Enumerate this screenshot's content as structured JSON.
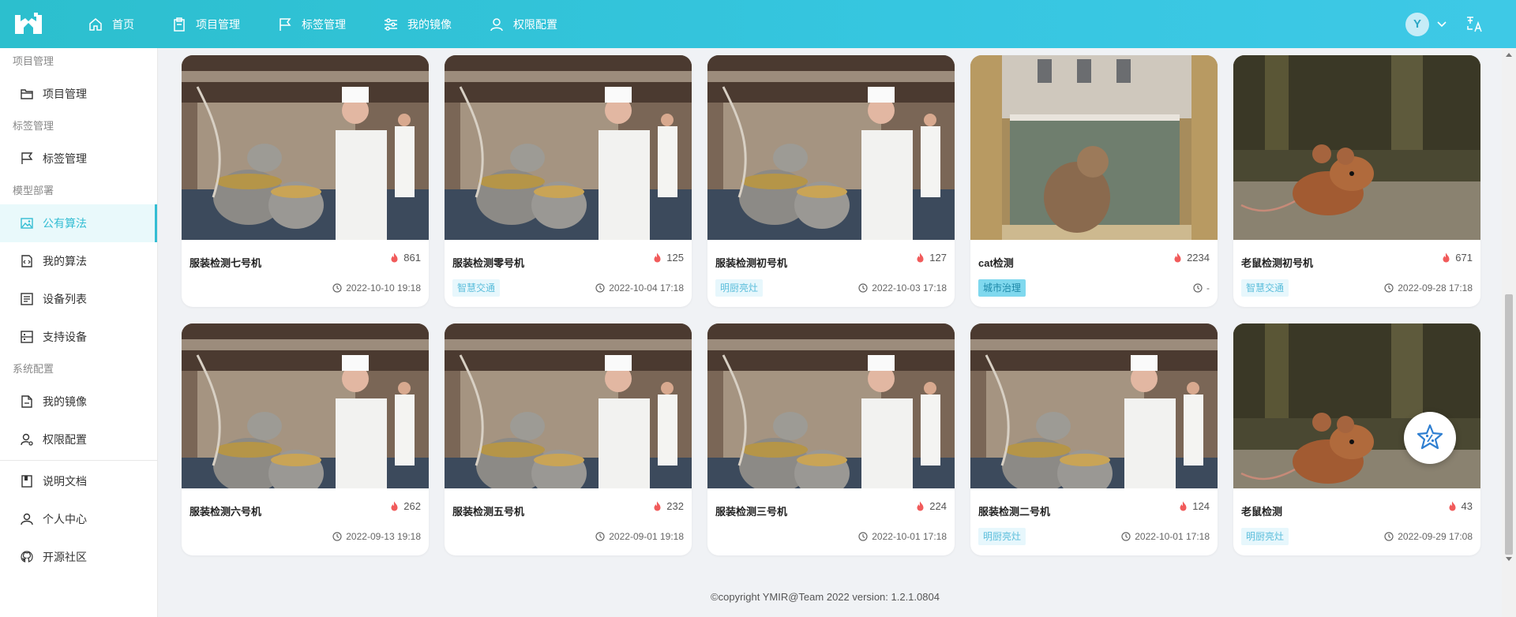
{
  "header": {
    "nav": [
      {
        "label": "首页",
        "icon": "home-icon"
      },
      {
        "label": "项目管理",
        "icon": "clipboard-icon"
      },
      {
        "label": "标签管理",
        "icon": "flag-icon"
      },
      {
        "label": "我的镜像",
        "icon": "sliders-icon"
      },
      {
        "label": "权限配置",
        "icon": "user-icon"
      }
    ],
    "avatar_letter": "Y"
  },
  "sidebar": {
    "group_project": "项目管理",
    "item_project": "项目管理",
    "group_label": "标签管理",
    "item_label": "标签管理",
    "group_model": "模型部署",
    "item_public_algo": "公有算法",
    "item_my_algo": "我的算法",
    "item_device_list": "设备列表",
    "item_support_device": "支持设备",
    "group_system": "系统配置",
    "item_my_image": "我的镜像",
    "item_permission": "权限配置",
    "item_docs": "说明文档",
    "item_personal": "个人中心",
    "item_community": "开源社区"
  },
  "cards": [
    {
      "title": "服装检测七号机",
      "hot": "861",
      "tag": "",
      "time": "2022-10-10 19:18",
      "img": "kitchen"
    },
    {
      "title": "服装检测零号机",
      "hot": "125",
      "tag": "智慧交通",
      "time": "2022-10-04 17:18",
      "img": "kitchen"
    },
    {
      "title": "服装检测初号机",
      "hot": "127",
      "tag": "明厨亮灶",
      "time": "2022-10-03 17:18",
      "img": "kitchen"
    },
    {
      "title": "cat检测",
      "hot": "2234",
      "tag": "城市治理",
      "time": "-",
      "img": "cat"
    },
    {
      "title": "老鼠检测初号机",
      "hot": "671",
      "tag": "智慧交通",
      "time": "2022-09-28 17:18",
      "img": "mouse"
    },
    {
      "title": "服装检测六号机",
      "hot": "262",
      "tag": "",
      "time": "2022-09-13 19:18",
      "img": "kitchen"
    },
    {
      "title": "服装检测五号机",
      "hot": "232",
      "tag": "",
      "time": "2022-09-01 19:18",
      "img": "kitchen"
    },
    {
      "title": "服装检测三号机",
      "hot": "224",
      "tag": "",
      "time": "2022-10-01 17:18",
      "img": "kitchen"
    },
    {
      "title": "服装检测二号机",
      "hot": "124",
      "tag": "明厨亮灶",
      "time": "2022-10-01 17:18",
      "img": "kitchen"
    },
    {
      "title": "老鼠检测",
      "hot": "43",
      "tag": "明厨亮灶",
      "time": "2022-09-29 17:08",
      "img": "mouse"
    }
  ],
  "footer": "©copyright YMIR@Team 2022 version: 1.2.1.0804",
  "colors": {
    "accent": "#33bdd3",
    "hot": "#f15b5b"
  }
}
